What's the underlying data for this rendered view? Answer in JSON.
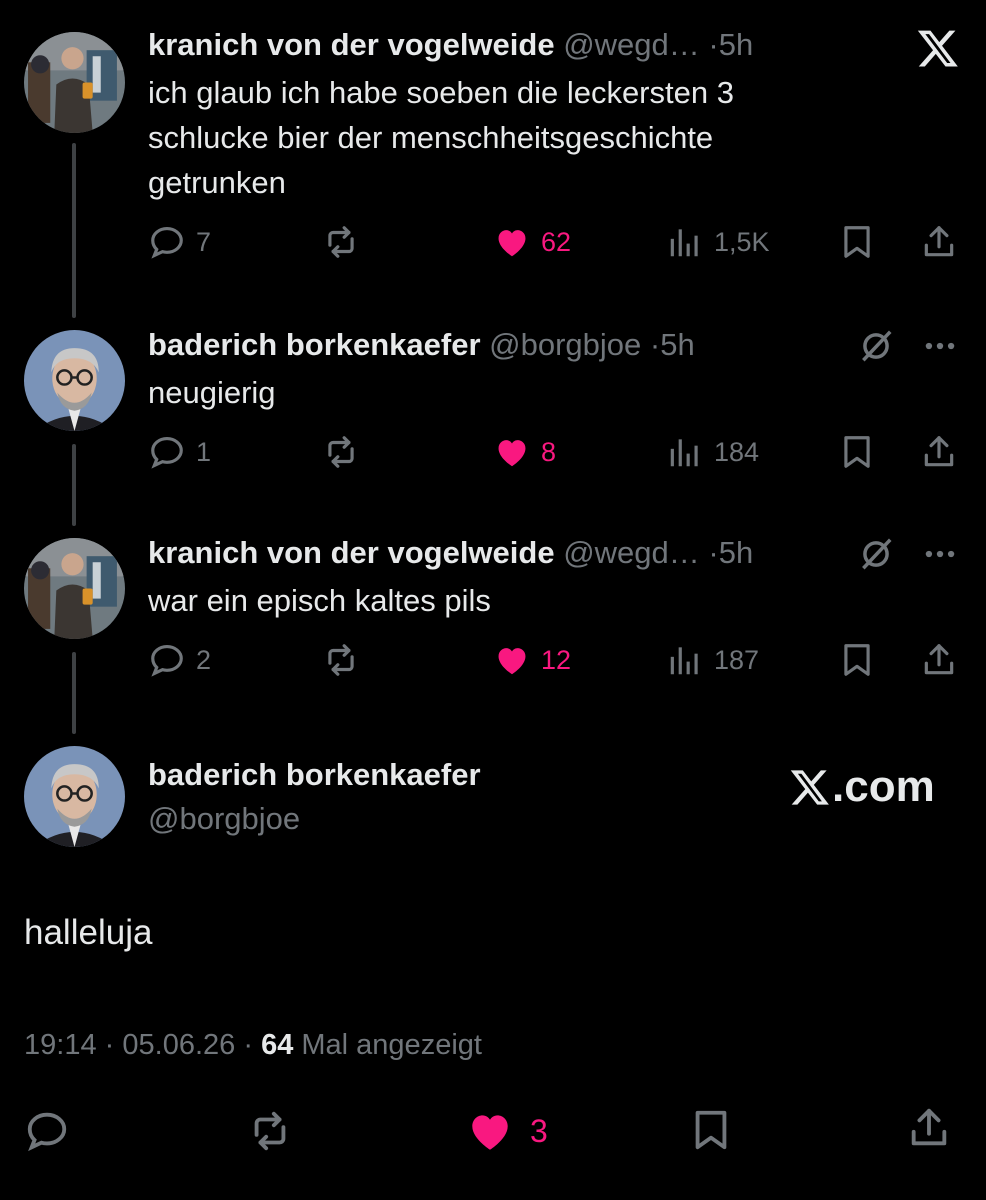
{
  "brand": {
    "x_logo": "X",
    "watermark": "X.com",
    "watermark_suffix": ".com"
  },
  "colors": {
    "background": "#000000",
    "text": "#e7e9ea",
    "muted": "#71767b",
    "like": "#f91880"
  },
  "thread": [
    {
      "avatar": "beer-man-avatar",
      "name": "kranich von der vogelweide",
      "handle": "@wegd…",
      "sep": "·",
      "time": "5h",
      "text_lines": [
        "ich glaub ich habe soeben die leckersten 3",
        "schlucke bier der menschheitsgeschichte",
        "getrunken"
      ],
      "replies": "7",
      "likes": "62",
      "views": "1,5K"
    },
    {
      "avatar": "glasses-man-avatar",
      "name": "baderich borkenkaefer",
      "handle": "@borgbjoe",
      "sep": "·",
      "time": "5h",
      "text_lines": [
        "neugierig"
      ],
      "replies": "1",
      "likes": "8",
      "views": "184"
    },
    {
      "avatar": "beer-man-avatar",
      "name": "kranich von der vogelweide",
      "handle": "@wegd…",
      "sep": "·",
      "time": "5h",
      "text_lines": [
        "war ein episch kaltes pils"
      ],
      "replies": "2",
      "likes": "12",
      "views": "187"
    }
  ],
  "main": {
    "name": "baderich borkenkaefer",
    "handle": "@borgbjoe",
    "text": "halleluja",
    "time": "19:14",
    "sep1": "·",
    "date": "05.06.26",
    "sep2": "·",
    "views_count": "64",
    "views_label": "Mal angezeigt",
    "likes": "3"
  }
}
